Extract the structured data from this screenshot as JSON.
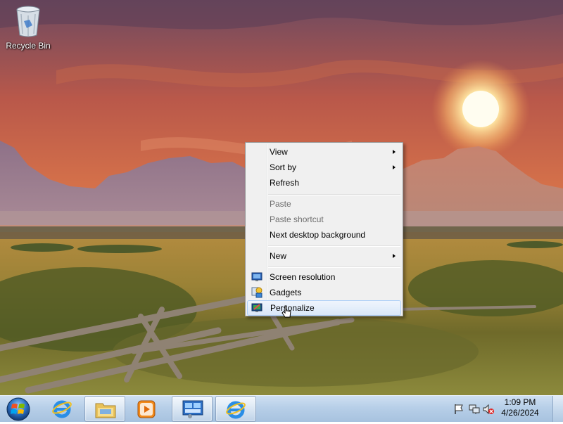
{
  "desktop": {
    "icons": [
      {
        "label": "Recycle Bin",
        "icon": "recycle-bin-icon"
      }
    ]
  },
  "context_menu": {
    "items": [
      {
        "label": "View",
        "submenu": true,
        "enabled": true
      },
      {
        "label": "Sort by",
        "submenu": true,
        "enabled": true
      },
      {
        "label": "Refresh",
        "submenu": false,
        "enabled": true
      },
      {
        "label": "Paste",
        "submenu": false,
        "enabled": false
      },
      {
        "label": "Paste shortcut",
        "submenu": false,
        "enabled": false
      },
      {
        "label": "Next desktop background",
        "submenu": false,
        "enabled": true
      },
      {
        "label": "New",
        "submenu": true,
        "enabled": true
      },
      {
        "label": "Screen resolution",
        "submenu": false,
        "enabled": true,
        "icon": "monitor-icon"
      },
      {
        "label": "Gadgets",
        "submenu": false,
        "enabled": true,
        "icon": "gadgets-icon"
      },
      {
        "label": "Personalize",
        "submenu": false,
        "enabled": true,
        "icon": "personalize-icon",
        "highlighted": true
      }
    ]
  },
  "taskbar": {
    "start_icon": "windows-logo-icon",
    "buttons": [
      {
        "icon": "internet-explorer-icon",
        "active": false
      },
      {
        "icon": "windows-explorer-icon",
        "active": true
      },
      {
        "icon": "media-player-icon",
        "active": false
      },
      {
        "icon": "control-panel-icon",
        "active": true
      },
      {
        "icon": "internet-explorer-icon",
        "active": true
      }
    ],
    "tray": {
      "icons": [
        "action-center-flag-icon",
        "network-icon",
        "volume-muted-icon"
      ],
      "time": "1:09 PM",
      "date": "4/26/2024"
    }
  },
  "colors": {
    "menu_background": "#f0f0f0",
    "menu_highlight": "#d9e7f8",
    "taskbar": "#b7cfe8"
  }
}
